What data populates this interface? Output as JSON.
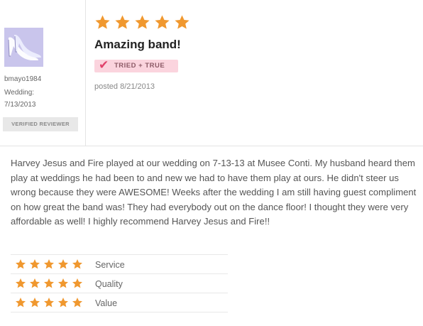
{
  "reviewer": {
    "username": "bmayo1984",
    "wedding_label": "Wedding:",
    "wedding_date": "7/13/2013",
    "verified_badge": "VERIFIED REVIEWER"
  },
  "review": {
    "rating": 5,
    "title": "Amazing band!",
    "badge": "TRIED + TRUE",
    "posted": "posted 8/21/2013",
    "body": "Harvey Jesus and Fire played at our wedding on 7-13-13 at Musee Conti. My husband heard them play at weddings he had been to and new we had to have them play at ours. He didn't steer us wrong because they were AWESOME! Weeks after the wedding I am still having guest compliment on how great the band was! They had everybody out on the dance floor! I thought they were very affordable as well! I highly recommend Harvey Jesus and Fire!!"
  },
  "ratings": [
    {
      "label": "Service",
      "stars": 5
    },
    {
      "label": "Quality",
      "stars": 5
    },
    {
      "label": "Value",
      "stars": 5
    }
  ],
  "colors": {
    "star": "#f0982f",
    "badge_bg": "#fbd4de",
    "check": "#e0426b"
  },
  "icons": {
    "avatar": "high-heel-shoe-icon",
    "star": "star-icon",
    "check": "checkmark-icon"
  }
}
